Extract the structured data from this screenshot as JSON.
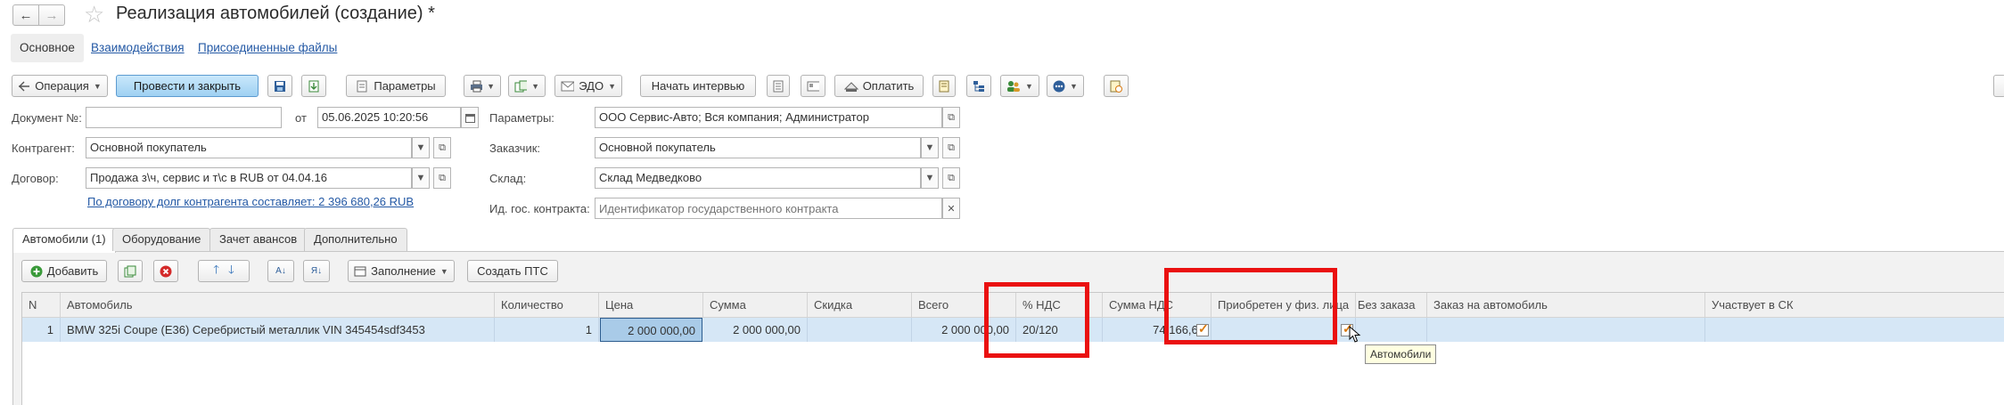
{
  "window": {
    "title": "Реализация автомобилей (создание) *"
  },
  "header": {
    "back_label": "🡐",
    "forward_label": "🡒"
  },
  "sections": [
    {
      "label": "Основное"
    },
    {
      "label": "Взаимодействия"
    },
    {
      "label": "Присоединенные файлы"
    }
  ],
  "toolbar": {
    "operation_label": "Операция",
    "post_close_label": "Провести и закрыть",
    "params_label": "Параметры",
    "edo_label": "ЭДО",
    "interview_label": "Начать интервью",
    "pay_label": "Оплатить"
  },
  "form": {
    "doc_no_label": "Документ №:",
    "doc_no_value": "",
    "from_label": "от",
    "date_value": "05.06.2025 10:20:56",
    "params_label": "Параметры:",
    "params_value": "ООО Сервис-Авто; Вся компания; Администратор",
    "counterparty_label": "Контрагент:",
    "counterparty_value": "Основной покупатель",
    "customer_label": "Заказчик:",
    "customer_value": "Основной покупатель",
    "contract_label": "Договор:",
    "contract_value": "Продажа з\\ч, сервис и т\\с в RUB от 04.04.16",
    "warehouse_label": "Склад:",
    "warehouse_value": "Склад Медведково",
    "debt_link": "По договору долг контрагента составляет: 2 396 680,26 RUB",
    "gov_label": "Ид. гос. контракта:",
    "gov_placeholder": "Идентификатор государственного контракта"
  },
  "tabs": [
    {
      "label": "Автомобили (1)"
    },
    {
      "label": "Оборудование"
    },
    {
      "label": "Зачет авансов"
    },
    {
      "label": "Дополнительно"
    }
  ],
  "table_toolbar": {
    "add_label": "Добавить",
    "fill_label": "Заполнение",
    "pts_label": "Создать ПТС"
  },
  "table": {
    "columns": [
      "N",
      "Автомобиль",
      "Количество",
      "Цена",
      "Сумма",
      "Скидка",
      "Всего",
      "% НДС",
      "Сумма НДС",
      "Приобретен у физ. лица",
      "Без заказа",
      "Заказ на автомобиль",
      "Участвует в СК"
    ],
    "rows": [
      {
        "n": "1",
        "car": "BMW 325i Coupe (E36) Серебристый металлик VIN 345454sdf3453",
        "qty": "1",
        "price": "2 000 000,00",
        "sum": "2 000 000,00",
        "discount": "",
        "total": "2 000 000,00",
        "vat_rate": "20/120",
        "vat_sum": "74 166,67",
        "bought_from_individual": true,
        "no_order": true,
        "order": "",
        "sk": ""
      }
    ]
  },
  "tooltip": {
    "text": "Автомобили"
  },
  "colors": {
    "highlight": "#ea1111",
    "primary_button": "#a8d5f3",
    "row_selected": "#d6e7f6"
  }
}
